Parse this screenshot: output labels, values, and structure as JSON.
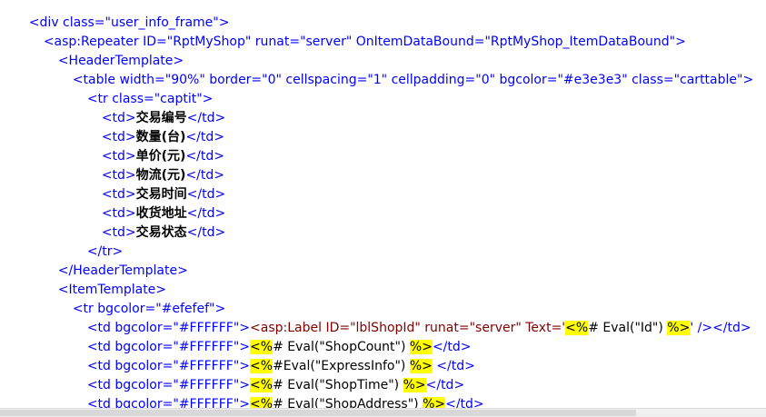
{
  "editor": {
    "lines": [
      [
        "<div class=\"user_info_frame\">"
      ],
      [
        "<asp:Repeater ID=\"RptMyShop\" runat=\"server\" OnItemDataBound=\"RptMyShop_ItemDataBound\">"
      ],
      [
        "<HeaderTemplate>"
      ],
      [
        "<table width=\"90%\" border=\"0\" cellspacing=\"1\" cellpadding=\"0\" bgcolor=\"#e3e3e3\" class=\"carttable\">"
      ],
      [
        "<tr class=\"captit\">"
      ],
      [
        "<td>",
        "交易编号",
        "</td>"
      ],
      [
        "<td>",
        "数量(台)",
        "</td>"
      ],
      [
        "<td>",
        "单价(元)",
        "</td>"
      ],
      [
        "<td>",
        "物流(元)",
        "</td>"
      ],
      [
        "<td>",
        "交易时间",
        "</td>"
      ],
      [
        "<td>",
        "收货地址",
        "</td>"
      ],
      [
        "<td>",
        "交易状态",
        "</td>"
      ],
      [
        "</tr>"
      ],
      [
        "</HeaderTemplate>"
      ],
      [
        "<ItemTemplate>"
      ],
      [
        "<tr bgcolor=\"#efefef\">"
      ],
      [
        "<td bgcolor=\"#FFFFFF\">",
        "<asp:Label ID=\"lblShopId\" runat=\"server\" Text='",
        "<%",
        "# Eval(\"Id\") ",
        "%>",
        "' />",
        "</td>"
      ],
      [
        "<td bgcolor=\"#FFFFFF\">",
        "<%",
        "# Eval(\"ShopCount\") ",
        "%>",
        "</td>"
      ],
      [
        "<td bgcolor=\"#FFFFFF\">",
        "<%",
        "#Eval(\"ExpressInfo\") ",
        "%>",
        " </td>"
      ],
      [
        "<td bgcolor=\"#FFFFFF\">",
        "<%",
        "# Eval(\"ShopTime\") ",
        "%>",
        "</td>"
      ],
      [
        "<td bgcolor=\"#FFFFFF\">",
        "<%",
        "# Eval(\"ShopAddress\") ",
        "%>",
        "</td>"
      ]
    ]
  }
}
